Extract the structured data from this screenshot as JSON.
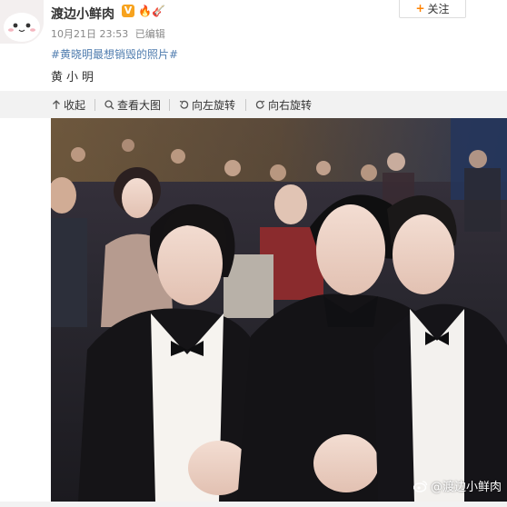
{
  "post": {
    "username": "渡边小鲜肉",
    "verified_mark": "V",
    "follow_label": "关注",
    "date": "10月21日 23:53",
    "edited": "已编辑",
    "hashtag": "#黄晓明最想销毁的照片#",
    "text": "黄小明",
    "badge_icons": [
      "flame-icon",
      "guitar-icon"
    ]
  },
  "toolbar": {
    "collapse": "收起",
    "view_large": "查看大图",
    "rotate_left": "向左旋转",
    "rotate_right": "向右旋转"
  },
  "image": {
    "watermark": "@渡边小鲜肉"
  },
  "colors": {
    "link": "#507daf",
    "accent": "#ff8200",
    "toolbar_bg": "#f2f2f2"
  }
}
